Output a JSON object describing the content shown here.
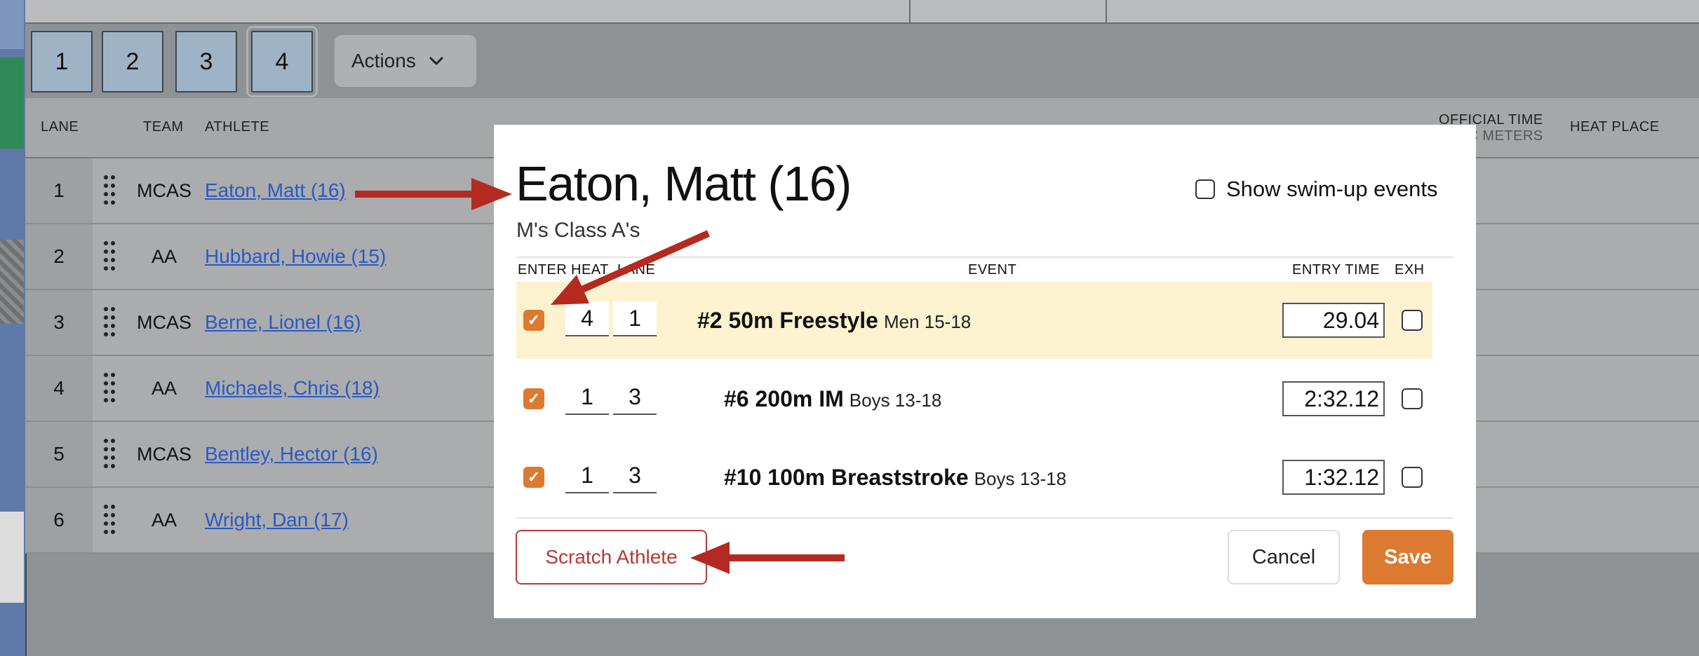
{
  "heat_tabs": [
    "1",
    "2",
    "3",
    "4"
  ],
  "actions_label": "Actions",
  "columns": {
    "lane": "LANE",
    "team": "TEAM",
    "athlete": "ATHLETE",
    "official_time": "OFFICIAL TIME",
    "official_time_sub": "C METERS",
    "heat_place": "HEAT PLACE"
  },
  "rows": [
    {
      "lane": "1",
      "team": "MCAS",
      "athlete": "Eaton, Matt (16)"
    },
    {
      "lane": "2",
      "team": "AA",
      "athlete": "Hubbard, Howie (15)"
    },
    {
      "lane": "3",
      "team": "MCAS",
      "athlete": "Berne, Lionel (16)"
    },
    {
      "lane": "4",
      "team": "AA",
      "athlete": "Michaels, Chris (18)"
    },
    {
      "lane": "5",
      "team": "MCAS",
      "athlete": "Bentley, Hector (16)"
    },
    {
      "lane": "6",
      "team": "AA",
      "athlete": "Wright, Dan (17)"
    }
  ],
  "modal": {
    "title": "Eaton, Matt (16)",
    "subtitle": "M's Class A's",
    "swimup_label": "Show swim-up events",
    "headers": {
      "enter": "ENTER",
      "heat": "HEAT",
      "lane": "LANE",
      "event": "EVENT",
      "entry_time": "ENTRY TIME",
      "exh": "EXH"
    },
    "events": [
      {
        "heat": "4",
        "lane": "1",
        "name": "#2 50m Freestyle",
        "group": "Men 15-18",
        "time": "29.04"
      },
      {
        "heat": "1",
        "lane": "3",
        "name": "#6 200m IM",
        "group": "Boys 13-18",
        "time": "2:32.12"
      },
      {
        "heat": "1",
        "lane": "3",
        "name": "#10 100m Breaststroke",
        "group": "Boys 13-18",
        "time": "1:32.12"
      }
    ],
    "scratch_label": "Scratch Athlete",
    "cancel_label": "Cancel",
    "save_label": "Save"
  },
  "colors": {
    "accent": "#dc7a31",
    "danger": "#b33a36",
    "highlight_row": "#fcf2cf",
    "annotation_arrow": "#b42a20",
    "link": "#2b59c3"
  }
}
